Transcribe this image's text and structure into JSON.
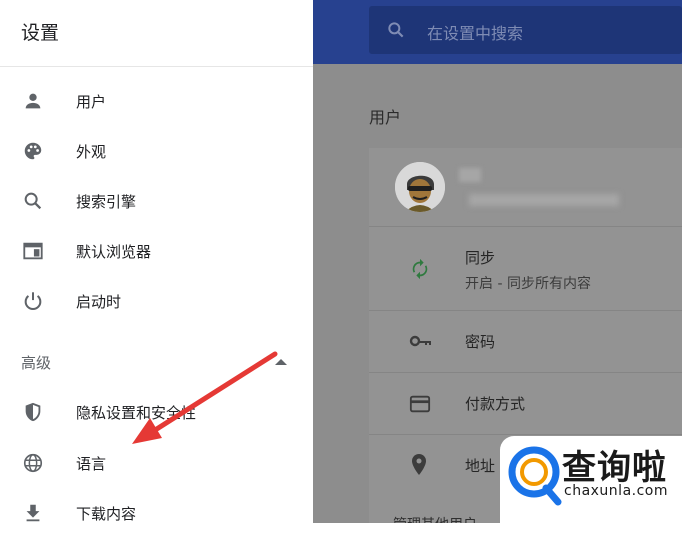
{
  "sidebar": {
    "title": "设置",
    "items": [
      {
        "label": "用户",
        "icon": "person-icon"
      },
      {
        "label": "外观",
        "icon": "palette-icon"
      },
      {
        "label": "搜索引擎",
        "icon": "search-icon"
      },
      {
        "label": "默认浏览器",
        "icon": "browser-icon"
      },
      {
        "label": "启动时",
        "icon": "power-icon"
      }
    ],
    "advanced_label": "高级",
    "advanced_items": [
      {
        "label": "隐私设置和安全性",
        "icon": "shield-icon"
      },
      {
        "label": "语言",
        "icon": "globe-icon"
      },
      {
        "label": "下载内容",
        "icon": "download-icon"
      }
    ]
  },
  "header": {
    "search_placeholder": "在设置中搜索"
  },
  "main": {
    "section_title": "用户",
    "sync": {
      "title": "同步",
      "subtitle": "开启 - 同步所有内容"
    },
    "password": {
      "title": "密码"
    },
    "payment": {
      "title": "付款方式"
    },
    "address": {
      "title": "地址"
    },
    "more_label": "管理其他用户"
  },
  "watermark": {
    "name": "查询啦",
    "domain": "chaxunla.com"
  },
  "colors": {
    "header_blue": "#27418f",
    "accent_blue": "#1a73e8",
    "sync_green": "#1e8e3e",
    "arrow_red": "#e53935"
  }
}
